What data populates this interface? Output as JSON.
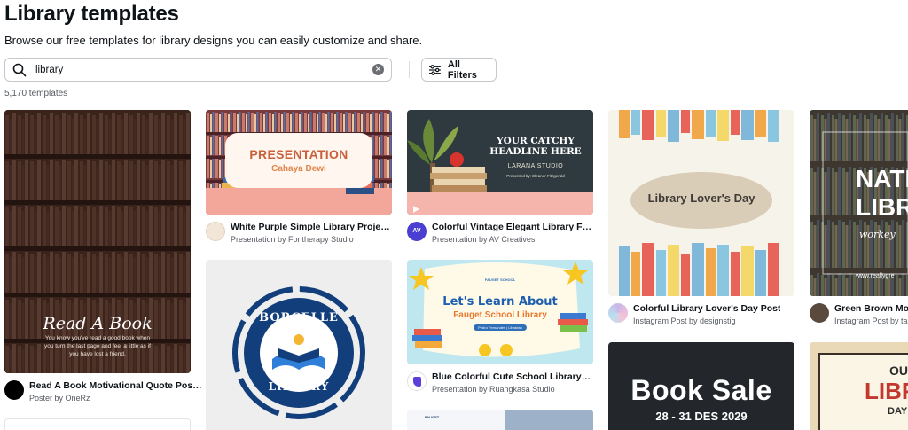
{
  "header": {
    "title": "Library templates",
    "subtitle": "Browse our free templates for library designs you can easily customize and share."
  },
  "search": {
    "value": "library",
    "clear_icon": "x-icon"
  },
  "filters": {
    "label": "All Filters"
  },
  "results": {
    "count": "5,170 templates"
  },
  "cards": [
    {
      "overlay_title": "Read A Book",
      "overlay_text": "You know you've read a good book when you turn the last page and feel a little as if you have lost a friend.",
      "title": "Read A Book Motivational Quote Pos…",
      "sub": "Poster by OneRz",
      "avatar_color": "#000000"
    },
    {
      "overlay_title": "PRESENTATION",
      "overlay_text": "Cahaya Dewi",
      "title": "White Purple Simple Library Project …",
      "sub": "Presentation by Fontherapy Studio",
      "avatar_color": "#f2e6d8"
    },
    {
      "overlay_title": "BORCELLE",
      "overlay_text": "LIBRARY"
    },
    {
      "overlay_title": "YOUR CATCHY HEADLINE HERE",
      "overlay_text": "LARANA STUDIO",
      "overlay_small": "Presented by: Eleanor Fitzgerald",
      "title": "Colorful Vintage Elegant Library Furn…",
      "sub": "Presentation by AV Creatives",
      "avatar_color": "#4b3fd1",
      "avatar_text": "AV"
    },
    {
      "overlay_title": "Let's Learn About",
      "overlay_text": "Fauget School Library",
      "overlay_small": "Pedro Fernandes | Librarian",
      "badge": "FAUGET SCHOOL",
      "title": "Blue Colorful Cute School Library Int…",
      "sub": "Presentation by Ruangkasa Studio",
      "avatar_color": "#ffffff"
    },
    {
      "overlay_title": "FAUGET"
    },
    {
      "overlay_title": "Library Lover's Day",
      "title": "Colorful Library Lover's Day Post",
      "sub": "Instagram Post by designstig",
      "avatar_color": "#c9b8e8"
    },
    {
      "overlay_title": "Book Sale",
      "overlay_text": "28 - 31 DES 2029"
    },
    {
      "overlay_title": "NATIO",
      "overlay_text": "LIBRA",
      "overlay_small": "workey",
      "overlay_url": "www.reallygre",
      "title": "Green Brown Mod",
      "sub": "Instagram Post by tar",
      "avatar_color": "#5a4a3e"
    },
    {
      "overlay_title": "OU",
      "overlay_text": "LIBRA",
      "overlay_small": "DAY"
    }
  ]
}
